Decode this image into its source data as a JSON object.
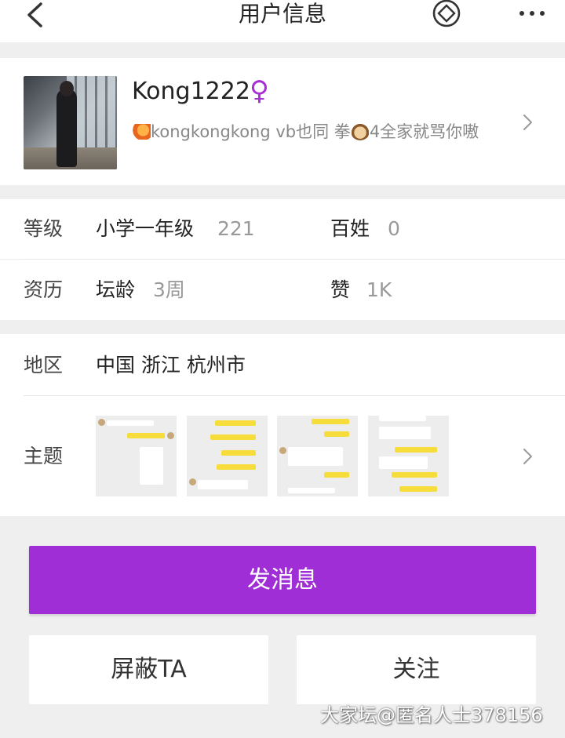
{
  "navbar": {
    "title": "用户信息",
    "back_icon": "back-chevron-icon",
    "diamond_icon": "diamond-icon",
    "more_icon": "more-dots-icon"
  },
  "profile": {
    "username": "Kong1222",
    "gender_symbol": "♀",
    "bio_part1": "kongkongkong vb也同 拳",
    "bio_part2": "4全家就骂你嗷",
    "accent_color": "#a72fd3"
  },
  "stats": {
    "level_label": "等级",
    "level_name": "小学一年级",
    "level_value": "221",
    "rank_key": "百姓",
    "rank_value": "0",
    "history_label": "资历",
    "age_key": "坛龄",
    "age_value": "3周",
    "like_key": "赞",
    "like_value": "1K"
  },
  "info": {
    "region_label": "地区",
    "region_value": "中国 浙江 杭州市",
    "topic_label": "主题",
    "topic_thumbs": [
      "chat-screenshot-1",
      "chat-screenshot-2",
      "chat-screenshot-3",
      "chat-screenshot-4"
    ]
  },
  "actions": {
    "message_label": "发消息",
    "block_label": "屏蔽TA",
    "follow_label": "关注",
    "primary_color": "#a02ed6"
  },
  "watermark": "大家坛@匿名人士378156"
}
